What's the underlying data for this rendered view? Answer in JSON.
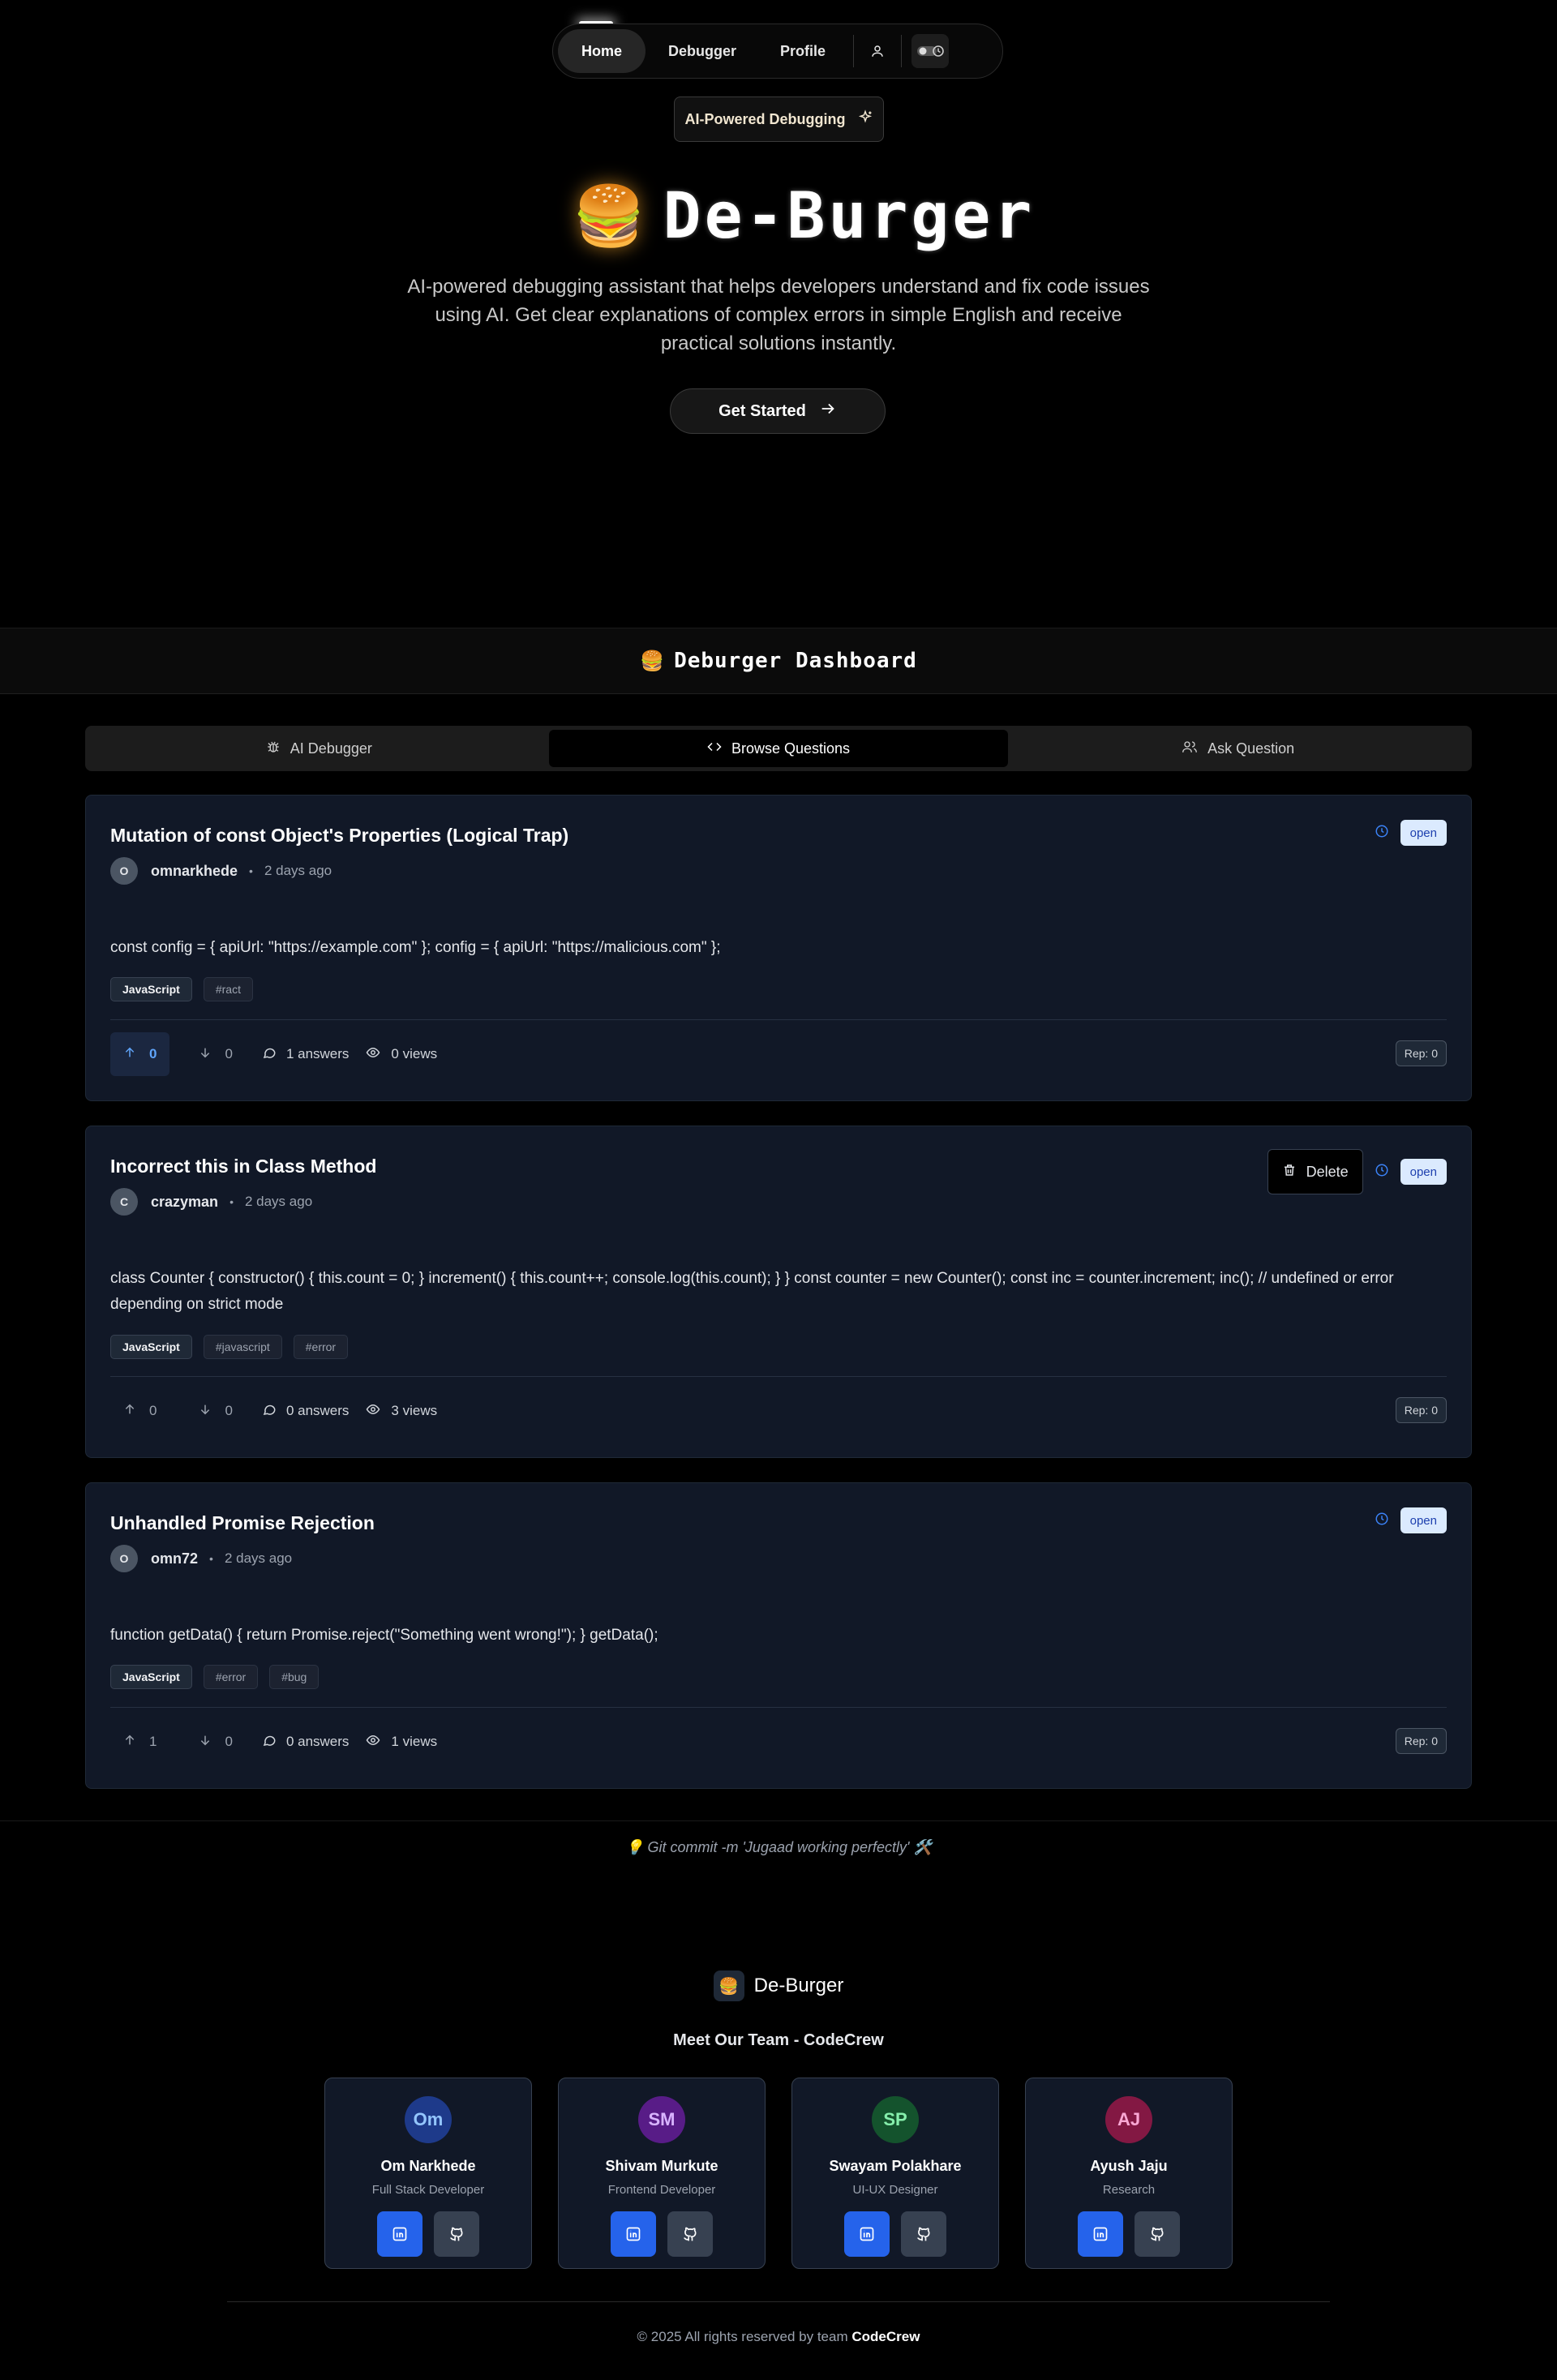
{
  "nav": {
    "items": [
      "Home",
      "Debugger",
      "Profile"
    ],
    "active": "Home"
  },
  "hero": {
    "badge": "AI-Powered Debugging",
    "title": "De-Burger",
    "description": "AI-powered debugging assistant that helps developers understand and fix code issues using AI. Get clear explanations of complex errors in simple English and receive practical solutions instantly.",
    "cta": "Get Started"
  },
  "dashboard": {
    "title": "Deburger Dashboard",
    "tabs": [
      "AI Debugger",
      "Browse Questions",
      "Ask Question"
    ],
    "active_tab": "Browse Questions"
  },
  "questions": [
    {
      "title": "Mutation of const Object's Properties (Logical Trap)",
      "avatar": "O",
      "author": "omnarkhede",
      "time": "2 days ago",
      "body": "const config = { apiUrl: \"https://example.com\" }; config = { apiUrl: \"https://malicious.com\" };",
      "language": "JavaScript",
      "tags": [
        "#ract"
      ],
      "upvotes": "0",
      "downvotes": "0",
      "answers": "1 answers",
      "views": "0 views",
      "rep": "Rep: 0",
      "status": "open"
    },
    {
      "title": "Incorrect this in Class Method",
      "avatar": "C",
      "author": "crazyman",
      "time": "2 days ago",
      "body": "class Counter { constructor() { this.count = 0; } increment() { this.count++; console.log(this.count); } } const counter = new Counter(); const inc = counter.increment; inc(); // undefined or error depending on strict mode",
      "language": "JavaScript",
      "tags": [
        "#javascript",
        "#error"
      ],
      "upvotes": "0",
      "downvotes": "0",
      "answers": "0 answers",
      "views": "3 views",
      "rep": "Rep: 0",
      "status": "open",
      "delete_label": "Delete"
    },
    {
      "title": "Unhandled Promise Rejection",
      "avatar": "O",
      "author": "omn72",
      "time": "2 days ago",
      "body": "function getData() { return Promise.reject(\"Something went wrong!\"); } getData();",
      "language": "JavaScript",
      "tags": [
        "#error",
        "#bug"
      ],
      "upvotes": "1",
      "downvotes": "0",
      "answers": "0 answers",
      "views": "1 views",
      "rep": "Rep: 0",
      "status": "open"
    }
  ],
  "footer": {
    "commit": "💡 Git commit -m 'Jugaad working perfectly' 🛠️",
    "brand": "De-Burger",
    "team_title": "Meet Our Team - CodeCrew",
    "team": [
      {
        "initials": "Om",
        "name": "Om Narkhede",
        "role": "Full Stack Developer",
        "color": "#1e3a8a",
        "text": "#93c5fd"
      },
      {
        "initials": "SM",
        "name": "Shivam Murkute",
        "role": "Frontend Developer",
        "color": "#581c87",
        "text": "#d8b4fe"
      },
      {
        "initials": "SP",
        "name": "Swayam Polakhare",
        "role": "UI-UX Designer",
        "color": "#14532d",
        "text": "#86efac"
      },
      {
        "initials": "AJ",
        "name": "Ayush Jaju",
        "role": "Research",
        "color": "#831843",
        "text": "#f9a8d4"
      }
    ],
    "copyright_prefix": "© 2025 All rights reserved by team",
    "copyright_team": "CodeCrew"
  },
  "colors": {
    "accent": "#60a5fa",
    "card_bg": "#111827",
    "open_badge": "#dbeafe",
    "linkedin": "#2563eb"
  },
  "icons": [
    "user-icon",
    "theme-toggle-icon",
    "sparkles-icon",
    "arrow-right-icon",
    "bug-icon",
    "code-icon",
    "users-icon",
    "clock-icon",
    "trash-icon",
    "arrow-up-icon",
    "arrow-down-icon",
    "comment-icon",
    "eye-icon",
    "linkedin-icon",
    "github-icon"
  ]
}
